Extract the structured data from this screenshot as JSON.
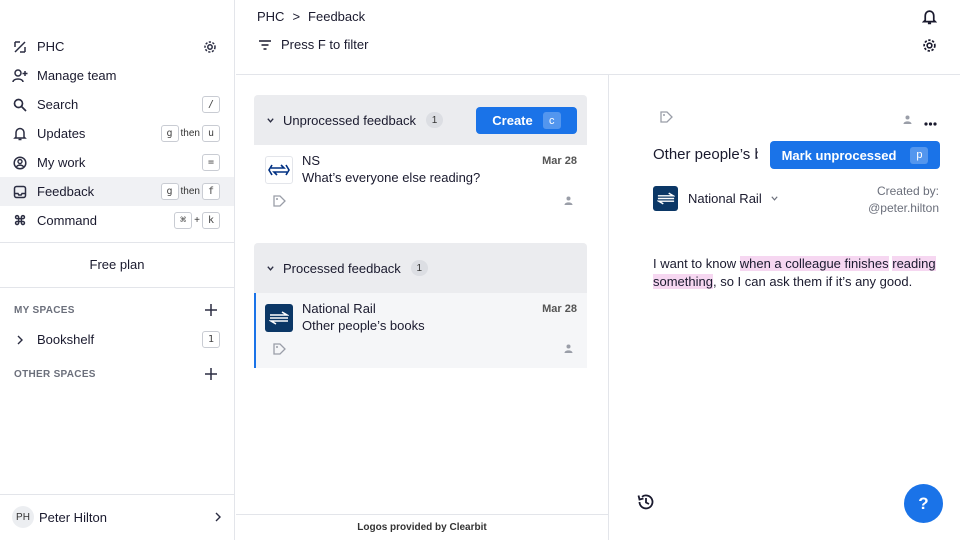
{
  "workspace": "PHC",
  "sidebar": {
    "items": [
      {
        "label": "PHC"
      },
      {
        "label": "Manage team"
      },
      {
        "label": "Search",
        "key": "/"
      },
      {
        "label": "Updates",
        "key1": "g",
        "then": "then",
        "key2": "u"
      },
      {
        "label": "My work",
        "key": "="
      },
      {
        "label": "Feedback",
        "key1": "g",
        "then": "then",
        "key2": "f"
      },
      {
        "label": "Command",
        "key1": "⌘",
        "plus": "+",
        "key2": "k"
      }
    ],
    "plan": "Free plan",
    "my_spaces_label": "MY SPACES",
    "spaces": [
      {
        "label": "Bookshelf",
        "count": "1"
      }
    ],
    "other_spaces_label": "OTHER SPACES",
    "user": {
      "initials": "PH",
      "name": "Peter Hilton"
    }
  },
  "header": {
    "breadcrumb_root": "PHC",
    "breadcrumb_sep": ">",
    "breadcrumb_current": "Feedback",
    "filter_hint": "Press F to filter"
  },
  "groups": {
    "unprocessed": {
      "title": "Unprocessed feedback",
      "count": "1",
      "create_label": "Create",
      "create_key": "c",
      "card": {
        "name": "NS",
        "desc": "What’s everyone else reading?",
        "date": "Mar 28"
      }
    },
    "processed": {
      "title": "Processed feedback",
      "count": "1",
      "card": {
        "name": "National Rail",
        "desc": "Other people’s books",
        "date": "Mar 28"
      }
    }
  },
  "footer": "Logos provided by Clearbit",
  "detail": {
    "title": "Other people’s books",
    "mark_label": "Mark unprocessed",
    "mark_key": "p",
    "company": "National Rail",
    "created_label": "Created by:",
    "created_by": "@peter.hilton",
    "body_pre": "I want to know ",
    "body_hl1": "when a colleague finishes",
    "body_space": " ",
    "body_hl2": "reading something",
    "body_post": ", so I can ask them if it’s any good."
  },
  "help_label": "?",
  "colors": {
    "accent": "#1a73e8",
    "highlight": "#f6d7f1",
    "ns_blue": "#003082",
    "national_rail": "#0b3766"
  }
}
